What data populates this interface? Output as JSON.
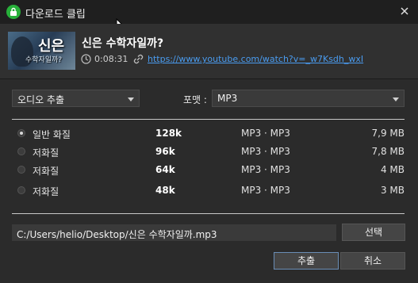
{
  "window": {
    "title": "다운로드 클립"
  },
  "video": {
    "title": "신은 수학자일까?",
    "duration": "0:08:31",
    "url": "https://www.youtube.com/watch?v=_w7Ksdh_wxI",
    "thumbnail_text_main": "신은",
    "thumbnail_text_sub": "수학자일까?"
  },
  "controls": {
    "mode_select": "오디오 추출",
    "format_label": "포맷 :",
    "format_select": "MP3"
  },
  "qualities": [
    {
      "quality": "일반 화질",
      "bitrate": "128k",
      "codec": "MP3 · MP3",
      "size": "7,9 MB",
      "selected": true
    },
    {
      "quality": "저화질",
      "bitrate": "96k",
      "codec": "MP3 · MP3",
      "size": "7,8 MB",
      "selected": false
    },
    {
      "quality": "저화질",
      "bitrate": "64k",
      "codec": "MP3 · MP3",
      "size": "4 MB",
      "selected": false
    },
    {
      "quality": "저화질",
      "bitrate": "48k",
      "codec": "MP3 · MP3",
      "size": "3 MB",
      "selected": false
    }
  ],
  "output": {
    "path": "C:/Users/helio/Desktop/신은 수학자일까.mp3",
    "browse_label": "선택"
  },
  "actions": {
    "extract_label": "추출",
    "cancel_label": "취소"
  },
  "colors": {
    "app_icon": "#27b03a",
    "link": "#4a9cf0",
    "background": "#2b2b2b"
  }
}
